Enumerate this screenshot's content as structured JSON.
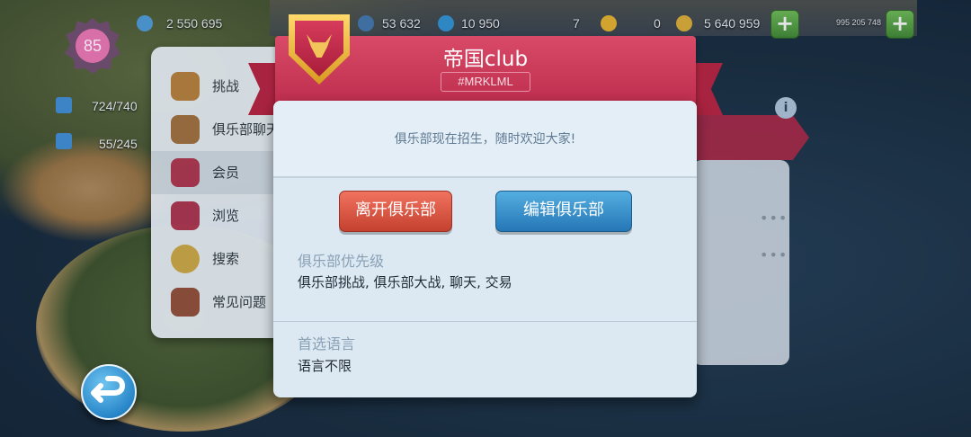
{
  "hud": {
    "level": "85",
    "population": "2 550 695",
    "simoleons_a": "53 632",
    "simcash": "10 950",
    "keys": "7",
    "golden_keys": "0",
    "money": "5 640 959",
    "small_value": "995 205 748"
  },
  "stats": {
    "storage": "724/740",
    "other": "55/245"
  },
  "menu": {
    "items": [
      {
        "label": "挑战",
        "icon": "chest-icon"
      },
      {
        "label": "俱乐部聊天",
        "icon": "chat-icon"
      },
      {
        "label": "会员",
        "icon": "members-shield-icon"
      },
      {
        "label": "浏览",
        "icon": "browse-shield-icon"
      },
      {
        "label": "搜索",
        "icon": "search-icon"
      },
      {
        "label": "常见问题",
        "icon": "faq-book-icon"
      }
    ]
  },
  "club": {
    "name": "帝国club",
    "tag": "#MRKLML",
    "description": "俱乐部现在招生，随时欢迎大家!",
    "leave_button": "离开俱乐部",
    "edit_button": "编辑俱乐部",
    "priority_label": "俱乐部优先级",
    "priority_value": "俱乐部挑战, 俱乐部大战, 聊天, 交易",
    "language_label": "首选语言",
    "language_value": "语言不限"
  },
  "colors": {
    "ribbon": "#c8345a",
    "leave": "#d8523f",
    "edit": "#3b93cf",
    "shield_gold": "#f2c45a"
  }
}
